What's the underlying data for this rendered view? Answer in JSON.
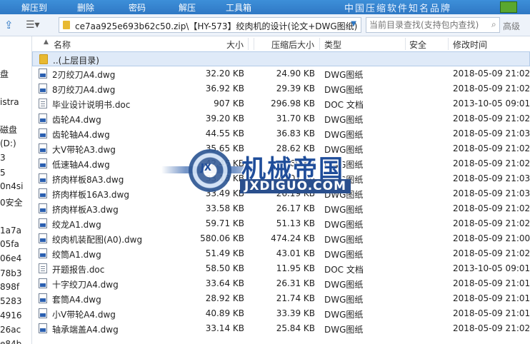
{
  "toolbar": {
    "items": [
      "解压到",
      "删除",
      "密码",
      "解压",
      "工具箱"
    ],
    "brand": "中国压缩软件知名品牌"
  },
  "addressbar": {
    "path": "ce7aa925e693b62c50.zip\\【HY-573】绞肉机的设计(论文+DWG图纸)",
    "search_placeholder": "当前目录查找(支持包内查找)",
    "advanced_label": "高级"
  },
  "tree": {
    "items": [
      "盘",
      "istra",
      "磁盘",
      "(D:)",
      "3",
      "5",
      "0n4si",
      "0安全",
      "1a7a",
      "05fa",
      "06e4",
      "78b3",
      "898f",
      "5283",
      "4916",
      "26ac",
      "e84b"
    ]
  },
  "columns": {
    "name": "名称",
    "size": "大小",
    "compressed": "压缩后大小",
    "type": "类型",
    "security": "安全",
    "modified": "修改时间"
  },
  "parent_row": "..(上层目录)",
  "files": [
    {
      "name": "2刃绞刀A4.dwg",
      "size": "32.20 KB",
      "compressed": "24.90 KB",
      "type": "DWG图纸",
      "modified": "2018-05-09 21:02:",
      "icon": "dwg-file-icon"
    },
    {
      "name": "8刃绞刀A4.dwg",
      "size": "36.92 KB",
      "compressed": "29.39 KB",
      "type": "DWG图纸",
      "modified": "2018-05-09 21:02:",
      "icon": "dwg-file-icon"
    },
    {
      "name": "毕业设计说明书.doc",
      "size": "907 KB",
      "compressed": "296.98 KB",
      "type": "DOC 文档",
      "modified": "2013-10-05 09:01:",
      "icon": "doc-file-icon"
    },
    {
      "name": "齿轮A4.dwg",
      "size": "39.20 KB",
      "compressed": "31.70 KB",
      "type": "DWG图纸",
      "modified": "2018-05-09 21:02:",
      "icon": "dwg-file-icon"
    },
    {
      "name": "齿轮轴A4.dwg",
      "size": "44.55 KB",
      "compressed": "36.83 KB",
      "type": "DWG图纸",
      "modified": "2018-05-09 21:03:",
      "icon": "dwg-file-icon"
    },
    {
      "name": "大V带轮A3.dwg",
      "size": "35.65 KB",
      "compressed": "28.62 KB",
      "type": "DWG图纸",
      "modified": "2018-05-09 21:02:",
      "icon": "dwg-file-icon"
    },
    {
      "name": "低速轴A4.dwg",
      "size": "42.46 KB",
      "compressed": "34.69 KB",
      "type": "DWG图纸",
      "modified": "2018-05-09 21:02:",
      "icon": "dwg-file-icon"
    },
    {
      "name": "挤肉样板8A3.dwg",
      "size": "33.18 KB",
      "compressed": "26.01 KB",
      "type": "DWG图纸",
      "modified": "2018-05-09 21:03:",
      "icon": "dwg-file-icon"
    },
    {
      "name": "挤肉样板16A3.dwg",
      "size": "33.49 KB",
      "compressed": "26.19 KB",
      "type": "DWG图纸",
      "modified": "2018-05-09 21:03:",
      "icon": "dwg-file-icon"
    },
    {
      "name": "挤肉样板A3.dwg",
      "size": "33.58 KB",
      "compressed": "26.17 KB",
      "type": "DWG图纸",
      "modified": "2018-05-09 21:02:",
      "icon": "dwg-file-icon"
    },
    {
      "name": "绞龙A1.dwg",
      "size": "59.71 KB",
      "compressed": "51.13 KB",
      "type": "DWG图纸",
      "modified": "2018-05-09 21:02:",
      "icon": "dwg-file-icon"
    },
    {
      "name": "绞肉机装配图(A0).dwg",
      "size": "580.06 KB",
      "compressed": "474.24 KB",
      "type": "DWG图纸",
      "modified": "2018-05-09 21:00:",
      "icon": "dwg-file-icon"
    },
    {
      "name": "绞筒A1.dwg",
      "size": "51.49 KB",
      "compressed": "43.01 KB",
      "type": "DWG图纸",
      "modified": "2018-05-09 21:02:",
      "icon": "dwg-file-icon"
    },
    {
      "name": "开题报告.doc",
      "size": "58.50 KB",
      "compressed": "11.95 KB",
      "type": "DOC 文档",
      "modified": "2013-10-05 09:01:",
      "icon": "doc-file-icon"
    },
    {
      "name": "十字绞刀A4.dwg",
      "size": "33.64 KB",
      "compressed": "26.31 KB",
      "type": "DWG图纸",
      "modified": "2018-05-09 21:01:",
      "icon": "dwg-file-icon"
    },
    {
      "name": "套筒A4.dwg",
      "size": "28.92 KB",
      "compressed": "21.74 KB",
      "type": "DWG图纸",
      "modified": "2018-05-09 21:01:",
      "icon": "dwg-file-icon"
    },
    {
      "name": "小V带轮A4.dwg",
      "size": "40.89 KB",
      "compressed": "33.39 KB",
      "type": "DWG图纸",
      "modified": "2018-05-09 21:01:",
      "icon": "dwg-file-icon"
    },
    {
      "name": "轴承端盖A4.dwg",
      "size": "33.14 KB",
      "compressed": "25.84 KB",
      "type": "DWG图纸",
      "modified": "2018-05-09 21:02:",
      "icon": "dwg-file-icon"
    }
  ],
  "watermark": {
    "badge": "JX",
    "title": "机械帝国",
    "url": "JXDIGUO.COM"
  }
}
